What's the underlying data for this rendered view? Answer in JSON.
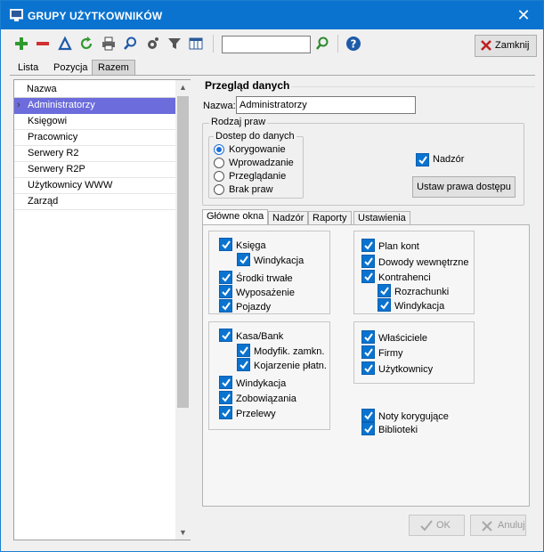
{
  "window": {
    "title": "GRUPY UŻYTKOWNIKÓW"
  },
  "toolbar": {
    "icons": [
      "add-icon",
      "remove-icon",
      "edit-icon",
      "refresh-icon",
      "print-icon",
      "search-icon",
      "settings-icon",
      "filter-icon",
      "columns-icon",
      "find-icon",
      "help-icon"
    ],
    "search_value": "",
    "close_label": "Zamknij",
    "colors": {
      "add": "#2e9a2e",
      "remove": "#d03030",
      "accent": "#0a73cf"
    }
  },
  "view_tabs": [
    "Lista",
    "Pozycja",
    "Razem"
  ],
  "list": {
    "header": "Nazwa",
    "items": [
      "Administratorzy",
      "Księgowi",
      "Pracownicy",
      "Serwery R2",
      "Serwery R2P",
      "Użytkownicy WWW",
      "Zarząd"
    ],
    "selected": 0
  },
  "overview": {
    "title": "Przegląd danych",
    "name_label": "Nazwa:",
    "name_value": "Administratorzy",
    "rights_group": "Rodzaj praw",
    "access_group": "Dostep do danych",
    "access_options": [
      "Korygowanie",
      "Wprowadzanie",
      "Przeglądanie",
      "Brak praw"
    ],
    "access_selected": 0,
    "supervision_label": "Nadzór",
    "set_rights_button": "Ustaw prawa dostępu"
  },
  "inner_tabs": [
    "Główne okna",
    "Nadzór",
    "Raporty",
    "Ustawienia"
  ],
  "modules": {
    "box1": {
      "main": [
        "Księga",
        "Środki trwałe",
        "Wyposażenie",
        "Pojazdy"
      ],
      "sub": [
        "Windykacja"
      ]
    },
    "box2": {
      "main": [
        "Kasa/Bank",
        "Windykacja",
        "Zobowiązania",
        "Przelewy"
      ],
      "sub": [
        "Modyfik. zamkn.",
        "Kojarzenie płatn."
      ]
    },
    "box3": {
      "main": [
        "Plan kont",
        "Dowody wewnętrzne",
        "Kontrahenci"
      ],
      "sub": [
        "Rozrachunki",
        "Windykacja"
      ]
    },
    "box4": {
      "main": [
        "Właściciele",
        "Firmy",
        "Użytkownicy"
      ]
    },
    "extra": [
      "Noty korygujące",
      "Biblioteki"
    ]
  },
  "footer": {
    "ok_label": "OK",
    "cancel_label": "Anuluj"
  }
}
